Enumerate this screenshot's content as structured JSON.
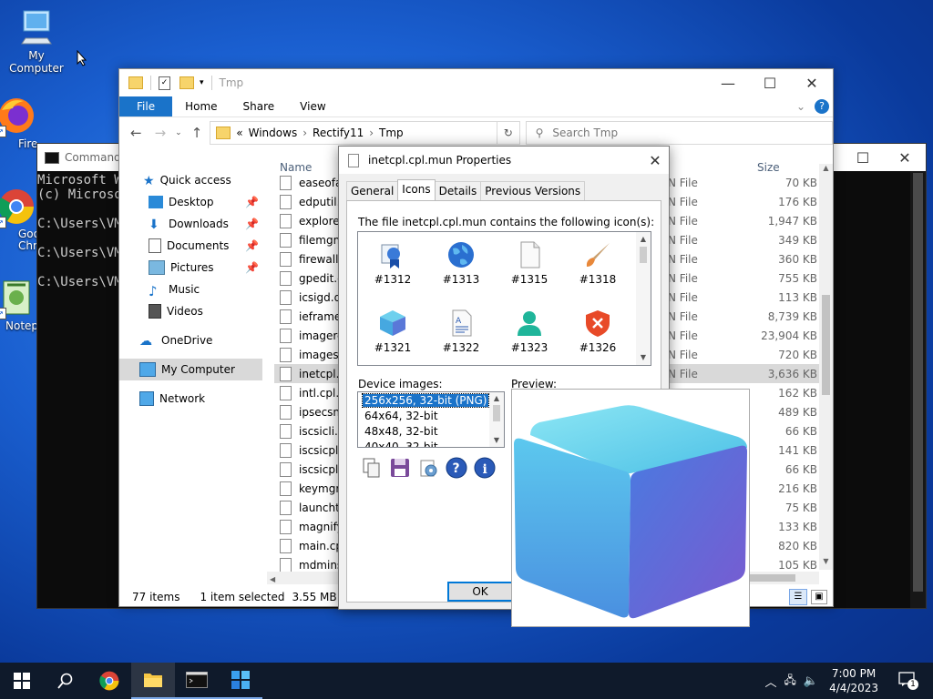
{
  "desktop": {
    "icons": [
      {
        "label": "My Computer"
      },
      {
        "label": "Fire"
      },
      {
        "label": "Goo"
      },
      {
        "label": "Chr"
      },
      {
        "label": "Notep"
      }
    ]
  },
  "cmd": {
    "title": "Command",
    "lines": [
      "Microsoft Wi",
      "(c) Microso",
      "",
      "C:\\Users\\VM",
      "",
      "C:\\Users\\VM",
      "",
      "C:\\Users\\VM"
    ]
  },
  "explorer": {
    "title": "Tmp",
    "ribbon": [
      "File",
      "Home",
      "Share",
      "View"
    ],
    "breadcrumb": [
      "«",
      "Windows",
      "Rectify11",
      "Tmp"
    ],
    "search_placeholder": "Search Tmp",
    "nav": [
      {
        "label": "Quick access"
      },
      {
        "label": "Desktop",
        "pinned": true
      },
      {
        "label": "Downloads",
        "pinned": true
      },
      {
        "label": "Documents",
        "pinned": true
      },
      {
        "label": "Pictures",
        "pinned": true
      },
      {
        "label": "Music"
      },
      {
        "label": "Videos"
      },
      {
        "label": "OneDrive"
      },
      {
        "label": "My Computer"
      },
      {
        "label": "Network"
      }
    ],
    "columns": {
      "name": "Name",
      "size": "Size"
    },
    "files": [
      {
        "name": "easeofac",
        "type": "N File",
        "size": "70 KB"
      },
      {
        "name": "edputil.c",
        "type": "N File",
        "size": "176 KB"
      },
      {
        "name": "explorer",
        "type": "N File",
        "size": "1,947 KB"
      },
      {
        "name": "filemgm",
        "type": "N File",
        "size": "349 KB"
      },
      {
        "name": "firewallc",
        "type": "N File",
        "size": "360 KB"
      },
      {
        "name": "gpedit.d",
        "type": "N File",
        "size": "755 KB"
      },
      {
        "name": "icsigd.dl",
        "type": "N File",
        "size": "113 KB"
      },
      {
        "name": "ieframe.",
        "type": "N File",
        "size": "8,739 KB"
      },
      {
        "name": "imagere",
        "type": "N File",
        "size": "23,904 KB"
      },
      {
        "name": "imagesp",
        "type": "N File",
        "size": "720 KB"
      },
      {
        "name": "inetcpl.",
        "type": "N File",
        "size": "3,636 KB",
        "selected": true
      },
      {
        "name": "intl.cpl.r",
        "type": "",
        "size": "162 KB"
      },
      {
        "name": "ipsecsnp",
        "type": "",
        "size": "489 KB"
      },
      {
        "name": "iscsicli.e",
        "type": "",
        "size": "66 KB"
      },
      {
        "name": "iscsicpl.",
        "type": "",
        "size": "141 KB"
      },
      {
        "name": "iscsicpl.",
        "type": "",
        "size": "66 KB"
      },
      {
        "name": "keymgr.",
        "type": "",
        "size": "216 KB"
      },
      {
        "name": "launchtr",
        "type": "",
        "size": "75 KB"
      },
      {
        "name": "magnify",
        "type": "",
        "size": "133 KB"
      },
      {
        "name": "main.cp",
        "type": "",
        "size": "820 KB"
      },
      {
        "name": "mdmins",
        "type": "",
        "size": "105 KB"
      }
    ],
    "status": {
      "count": "77 items",
      "selected": "1 item selected",
      "size": "3.55 MB"
    }
  },
  "props": {
    "title": "inetcpl.cpl.mun Properties",
    "tabs": [
      "General",
      "Icons",
      "Details",
      "Previous Versions"
    ],
    "active_tab": "Icons",
    "description": "The file inetcpl.cpl.mun contains the following icon(s):",
    "icons": [
      {
        "id": "#1312",
        "icon": "network-settings-icon"
      },
      {
        "id": "#1313",
        "icon": "globe-icon"
      },
      {
        "id": "#1315",
        "icon": "blank-page-icon"
      },
      {
        "id": "#1318",
        "icon": "paintbrush-icon"
      },
      {
        "id": "#1321",
        "icon": "cube-icon"
      },
      {
        "id": "#1322",
        "icon": "document-icon"
      },
      {
        "id": "#1323",
        "icon": "user-icon"
      },
      {
        "id": "#1326",
        "icon": "shield-error-icon"
      }
    ],
    "device_images_label": "Device images:",
    "device_images": [
      "256x256, 32-bit (PNG)",
      "64x64, 32-bit",
      "48x48, 32-bit",
      "40x40, 32-bit"
    ],
    "preview_label": "Preview:",
    "ok_label": "OK"
  },
  "taskbar": {
    "time": "7:00 PM",
    "date": "4/4/2023",
    "notification_count": "1"
  },
  "colors": {
    "accent": "#1a73c9",
    "selection": "#cce8ff"
  }
}
